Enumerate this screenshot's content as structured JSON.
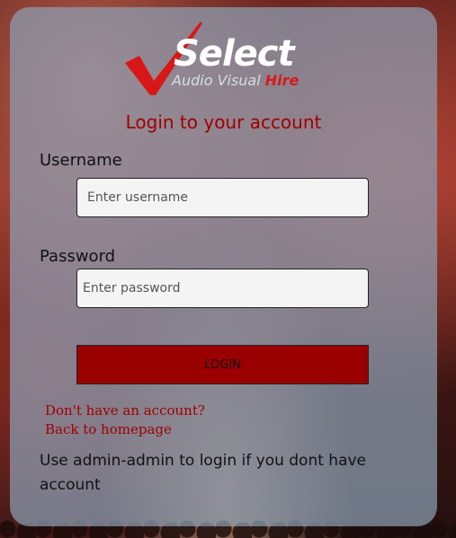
{
  "brand": {
    "name": "Select",
    "sub_text": "Audio Visual",
    "sub_highlight": "Hire",
    "check_color": "#d81818"
  },
  "form": {
    "title": "Login to your account",
    "username_label": "Username",
    "username_placeholder": "Enter username",
    "password_label": "Password",
    "password_placeholder": "Enter password",
    "login_label": "LOGIN"
  },
  "links": {
    "signup": "Don't have an account?",
    "home": "Back to homepage"
  },
  "hint": "Use admin-admin to login if you dont have account",
  "colors": {
    "accent": "#a00000",
    "button": "#9a0000",
    "card": "#8ca0b4"
  }
}
